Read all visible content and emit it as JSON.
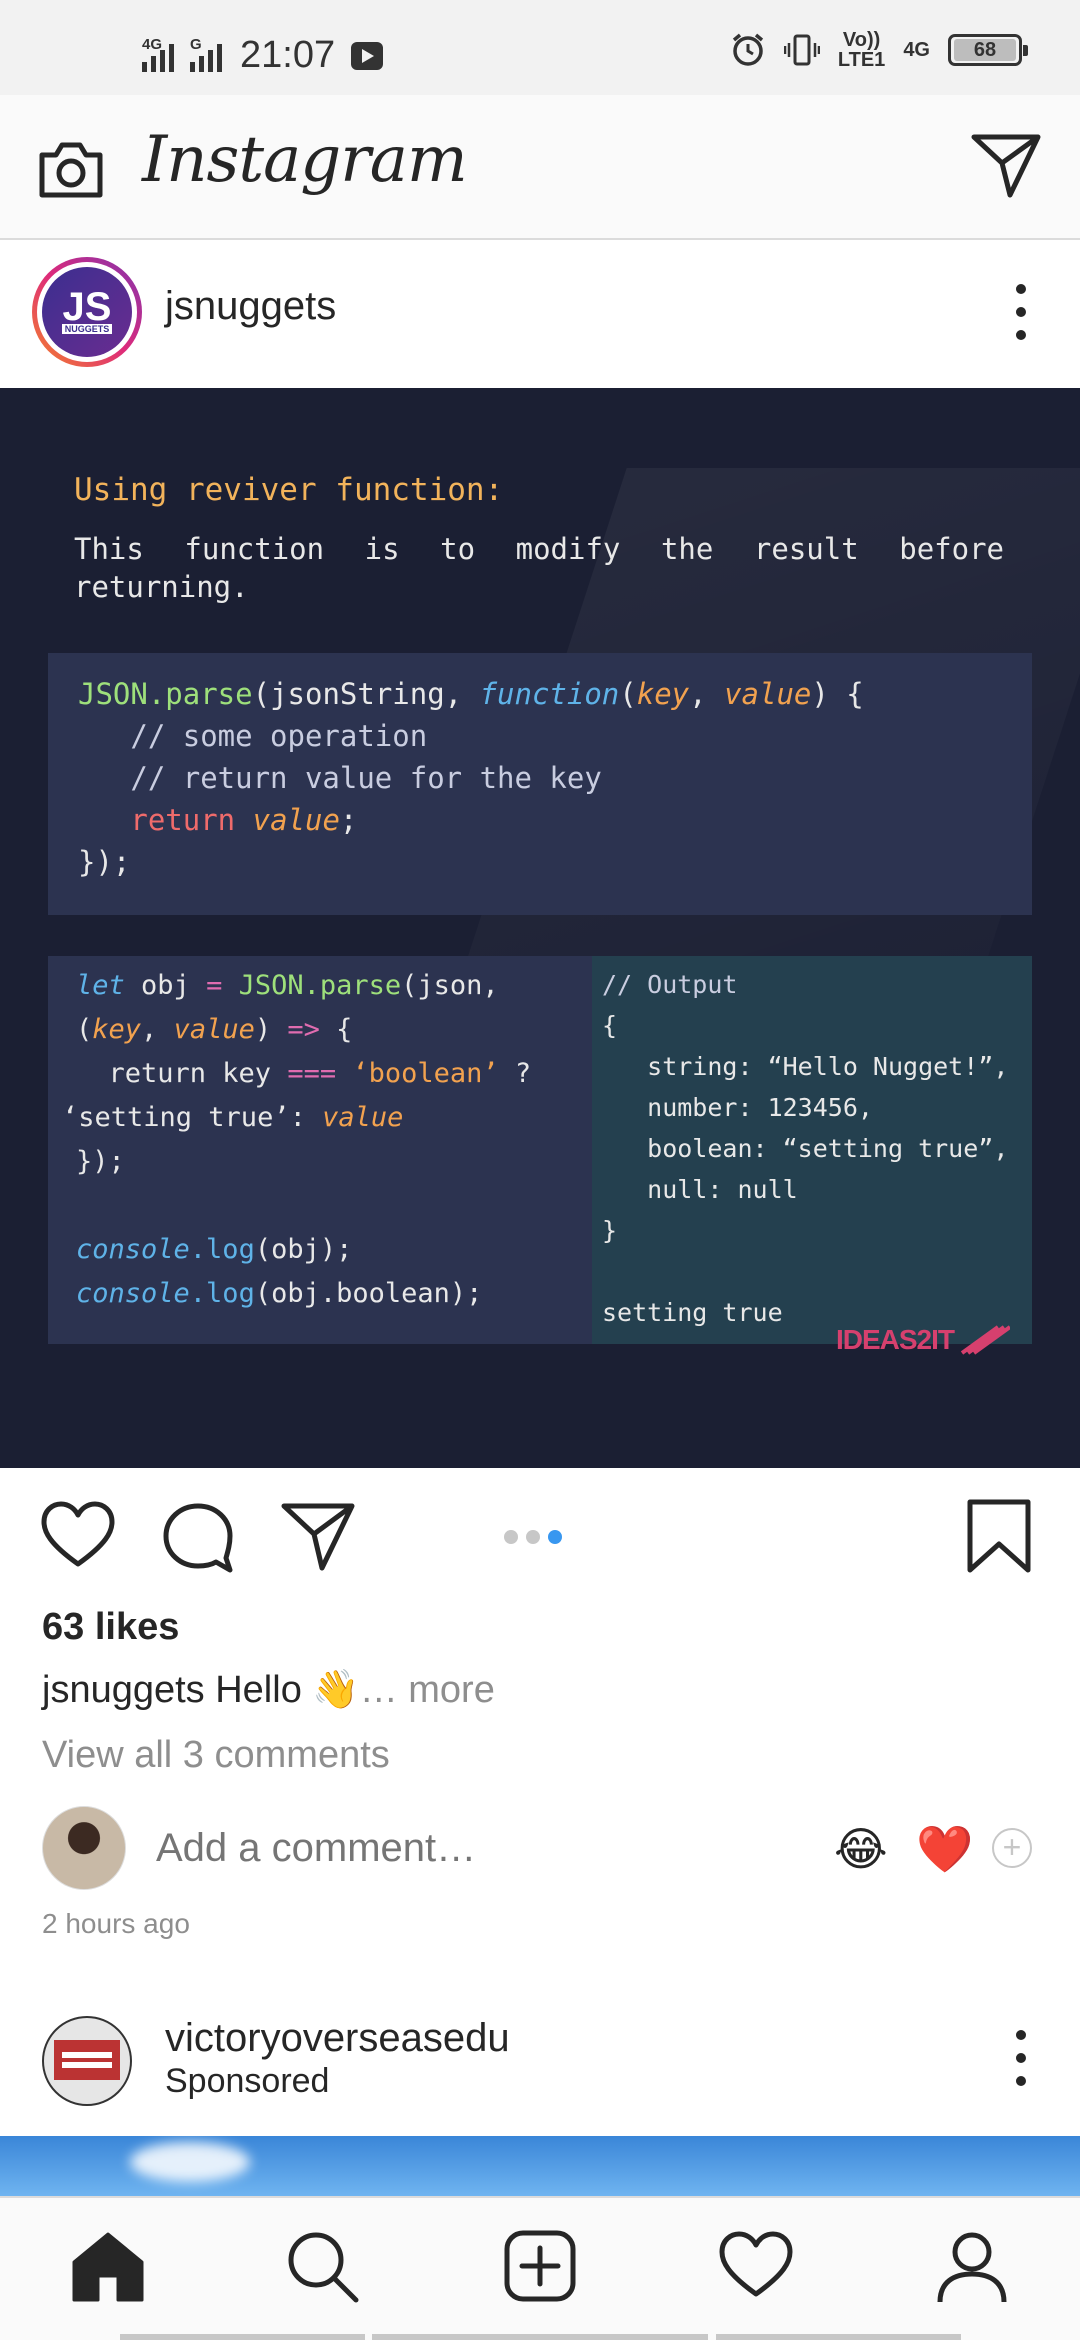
{
  "status_bar": {
    "net1": "4G",
    "net2": "G",
    "time": "21:07",
    "volte": "Vo))",
    "lte": "LTE1",
    "net3": "4G",
    "battery": "68"
  },
  "header": {
    "app_name": "Instagram"
  },
  "post": {
    "username": "jsnuggets",
    "avatar_text": "JS",
    "avatar_sub": "NUGGETS",
    "image": {
      "title": "Using reviver function:",
      "description_line1": "This function is to modify the result before",
      "description_line2": "returning.",
      "code1": {
        "l1_a": "JSON.parse",
        "l1_b": "(jsonString, ",
        "l1_c": "function",
        "l1_d": "(",
        "l1_e": "key",
        "l1_f": ", ",
        "l1_g": "value",
        "l1_h": ") {",
        "l2": "   // some operation",
        "l3": "   // return value for the key",
        "l4_a": "   return ",
        "l4_b": "value",
        "l4_c": ";",
        "l5": "});"
      },
      "code2": {
        "l1_a": "let",
        "l1_b": " obj ",
        "l1_c": "=",
        "l1_d": " JSON.parse",
        "l1_e": "(json,",
        "l2_a": "(",
        "l2_b": "key",
        "l2_c": ", ",
        "l2_d": "value",
        "l2_e": ") ",
        "l2_f": "=>",
        "l2_g": " {",
        "l3_a": "  return key ",
        "l3_b": "===",
        "l3_c": " ‘boolean’",
        "l3_d": " ?",
        "l4_a": "‘setting true’",
        "l4_b": ": ",
        "l4_c": "value",
        "l5": "});",
        "l6_a": "console",
        "l6_b": ".log",
        "l6_c": "(obj);",
        "l7_a": "console",
        "l7_b": ".log",
        "l7_c": "(obj.boolean);"
      },
      "output": {
        "l1": "// Output",
        "l2": "{",
        "l3": "   string: “Hello Nugget!”,",
        "l4": "   number: 123456,",
        "l5": "   boolean: “setting true”,",
        "l6": "   null: null",
        "l7": "}",
        "l8": "setting true"
      },
      "brand": "IDEAS2IT"
    },
    "likes": "63 likes",
    "caption_user": "jsnuggets",
    "caption_text": " Hello 👋",
    "caption_more": "… more",
    "view_comments": "View all 3 comments",
    "comment_placeholder": "Add a comment…",
    "emoji1": "😂",
    "emoji2": "❤️",
    "timestamp": "2 hours ago"
  },
  "next_post": {
    "username": "victoryoverseasedu",
    "sponsored": "Sponsored"
  },
  "icons": {
    "camera": "camera-icon",
    "direct": "send-icon",
    "like": "heart-icon",
    "comment": "comment-icon",
    "share": "send-icon",
    "save": "bookmark-icon",
    "nav": [
      "home-icon",
      "search-icon",
      "add-post-icon",
      "heart-icon",
      "profile-icon"
    ]
  },
  "colors": {
    "carousel_active": "#3897f0",
    "code_bg": "#1b1f33",
    "brand": "#d6406e"
  }
}
